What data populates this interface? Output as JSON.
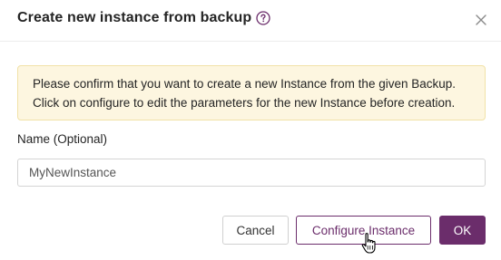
{
  "dialog": {
    "title": "Create new instance from backup",
    "help_icon": "question-circle-icon",
    "close_icon": "close-icon"
  },
  "notice": {
    "line1": "Please confirm that you want to create a new Instance from the given Backup.",
    "line2": "Click on configure to edit the parameters for the new Instance before creation.",
    "bg_color": "#fdf6e0"
  },
  "form": {
    "name_label": "Name (Optional)",
    "name_value": "MyNewInstance"
  },
  "buttons": {
    "cancel": "Cancel",
    "configure": "Configure Instance",
    "ok": "OK"
  },
  "colors": {
    "accent": "#6b2d6b"
  },
  "cursor": "hand-pointer-icon"
}
